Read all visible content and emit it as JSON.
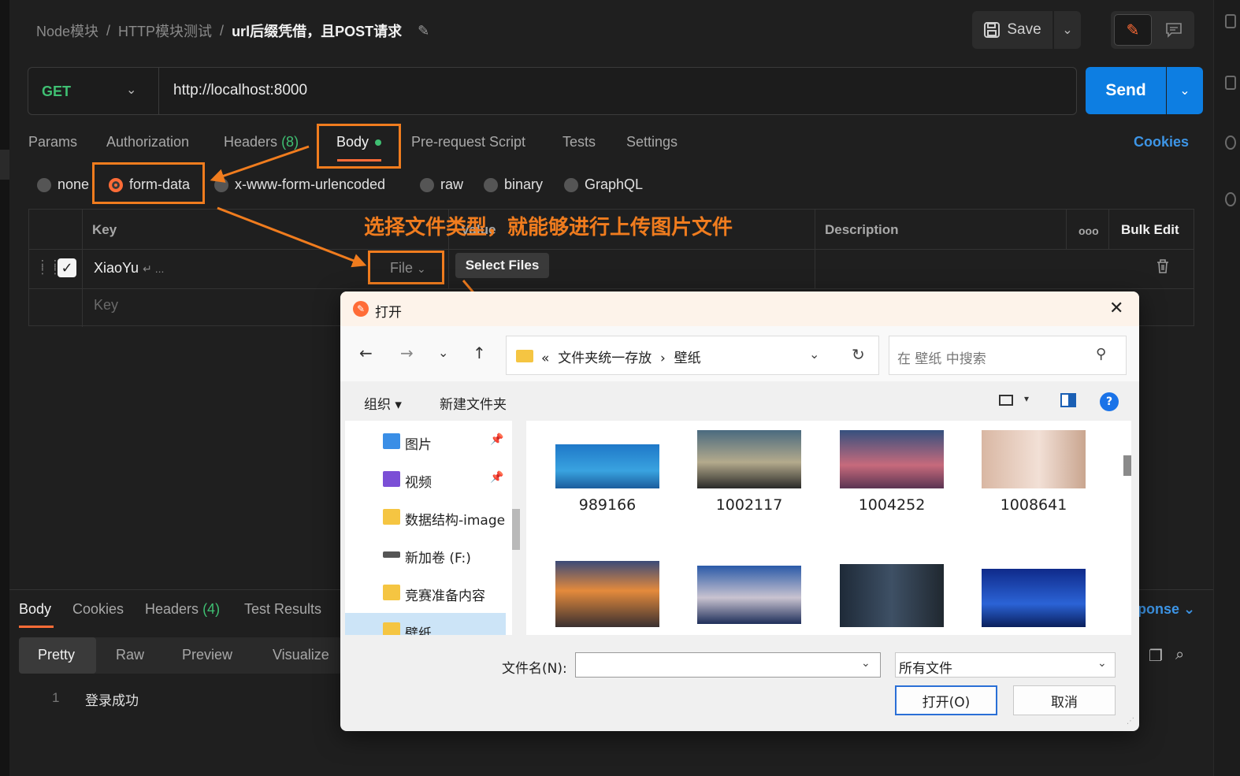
{
  "breadcrumb": {
    "items": [
      "Node模块",
      "HTTP模块测试"
    ],
    "separator": "/",
    "current": "url后缀凭借，且POST请求",
    "edit_icon": "pencil-icon"
  },
  "header": {
    "save_label": "Save",
    "save_icon": "floppy-icon",
    "mode_edit_icon": "pencil-icon",
    "mode_comment_icon": "comment-icon"
  },
  "request": {
    "method": "GET",
    "url": "http://localhost:8000",
    "send_label": "Send"
  },
  "tabs": [
    {
      "label": "Params"
    },
    {
      "label": "Authorization"
    },
    {
      "label": "Headers",
      "count": "(8)"
    },
    {
      "label": "Body",
      "active": true
    },
    {
      "label": "Pre-request Script"
    },
    {
      "label": "Tests"
    },
    {
      "label": "Settings"
    }
  ],
  "cookies_label": "Cookies",
  "body_modes": [
    "none",
    "form-data",
    "x-www-form-urlencoded",
    "raw",
    "binary",
    "GraphQL"
  ],
  "body_mode_selected": "form-data",
  "form_table": {
    "headers": {
      "key": "Key",
      "value": "Value",
      "description": "Description",
      "more": "ooo",
      "bulk_edit": "Bulk Edit"
    },
    "rows": [
      {
        "checked": true,
        "key": "XiaoYu",
        "key_suffix": "↵ ...",
        "type": "File",
        "value_button": "Select Files"
      }
    ],
    "key_placeholder": "Key"
  },
  "annotation": {
    "text": "选择文件类型，就能够进行上传图片文件",
    "color": "#f07c1e"
  },
  "response": {
    "tabs": [
      {
        "label": "Body",
        "active": true
      },
      {
        "label": "Cookies"
      },
      {
        "label": "Headers",
        "count": "(4)"
      },
      {
        "label": "Test Results"
      }
    ],
    "views": [
      "Pretty",
      "Raw",
      "Preview",
      "Visualize"
    ],
    "view_selected": "Pretty",
    "lines": [
      {
        "no": "1",
        "text": "登录成功"
      }
    ],
    "save_response_fragment": "ponse"
  },
  "dialog": {
    "title": "打开",
    "address": {
      "prefix": "«",
      "path1": "文件夹统一存放",
      "arrow": "›",
      "path2": "壁纸"
    },
    "search_placeholder": "在 壁纸 中搜索",
    "commands": {
      "organize": "组织 ▾",
      "new_folder": "新建文件夹"
    },
    "sidebar": [
      {
        "label": "图片",
        "pinned": true,
        "icon": "pictures-icon",
        "color": "#3a8ee6"
      },
      {
        "label": "视频",
        "pinned": true,
        "icon": "videos-icon",
        "color": "#7b4fd6"
      },
      {
        "label": "数据结构-image",
        "pinned": false,
        "icon": "folder-icon",
        "color": "#f5c542"
      },
      {
        "label": "新加卷 (F:)",
        "pinned": false,
        "icon": "drive-icon",
        "color": "#555555"
      },
      {
        "label": "竞赛准备内容",
        "pinned": false,
        "icon": "folder-icon",
        "color": "#f5c542"
      },
      {
        "label": "壁纸",
        "pinned": false,
        "icon": "folder-icon",
        "color": "#f5c542",
        "selected": true
      }
    ],
    "files": [
      {
        "name": "989166"
      },
      {
        "name": "1002117"
      },
      {
        "name": "1004252"
      },
      {
        "name": "1008641"
      },
      {
        "name": ""
      },
      {
        "name": ""
      },
      {
        "name": ""
      },
      {
        "name": ""
      }
    ],
    "filename_label": "文件名(N):",
    "filename_value": "",
    "filetype_value": "所有文件",
    "open_label": "打开(O)",
    "cancel_label": "取消"
  },
  "colors": {
    "accent": "#ff6c37",
    "send": "#0d7ee2",
    "method_get": "#3fbf72",
    "annotation": "#f07c1e",
    "link": "#3d95e6"
  }
}
